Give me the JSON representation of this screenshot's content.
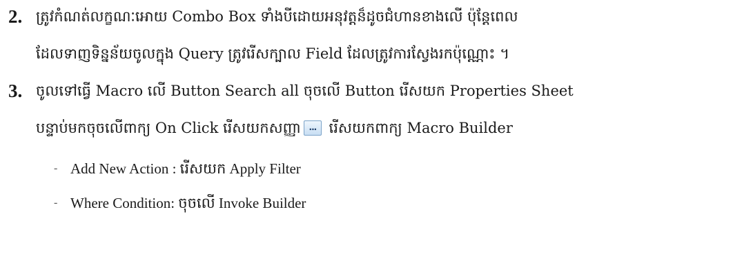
{
  "steps": [
    {
      "number": "2.",
      "lines": [
        "ត្រូវកំណត់លក្ខណៈអោយ Combo Box ទាំងបីដោយអនុវត្តន៏ដូចជំហានខាងលើ ប៉ុន្តែពេល",
        "ដែលទាញទិន្នន័យចូលក្នុង Query ត្រូវរើសក្បាល Field ដែលត្រូវការស្វែងរកប៉ុណ្ណោះ ។"
      ]
    },
    {
      "number": "3.",
      "lines": [
        "ចូលទៅធ្វើ Macro លើ Button Search all  ចុចលើ Button រើសយក Properties Sheet"
      ],
      "line2_before_icon": "បន្ទាប់មកចុចលើពាក្យ On Click  រើសយកសញ្ញា",
      "icon": {
        "name": "ellipsis-builder-icon",
        "glyph": "..."
      },
      "line2_after_icon": "  រើសយកពាក្យ Macro Builder",
      "subitems": [
        "Add New Action : រើសយក Apply Filter",
        "Where Condition: ចុចលើ Invoke Builder"
      ]
    }
  ]
}
